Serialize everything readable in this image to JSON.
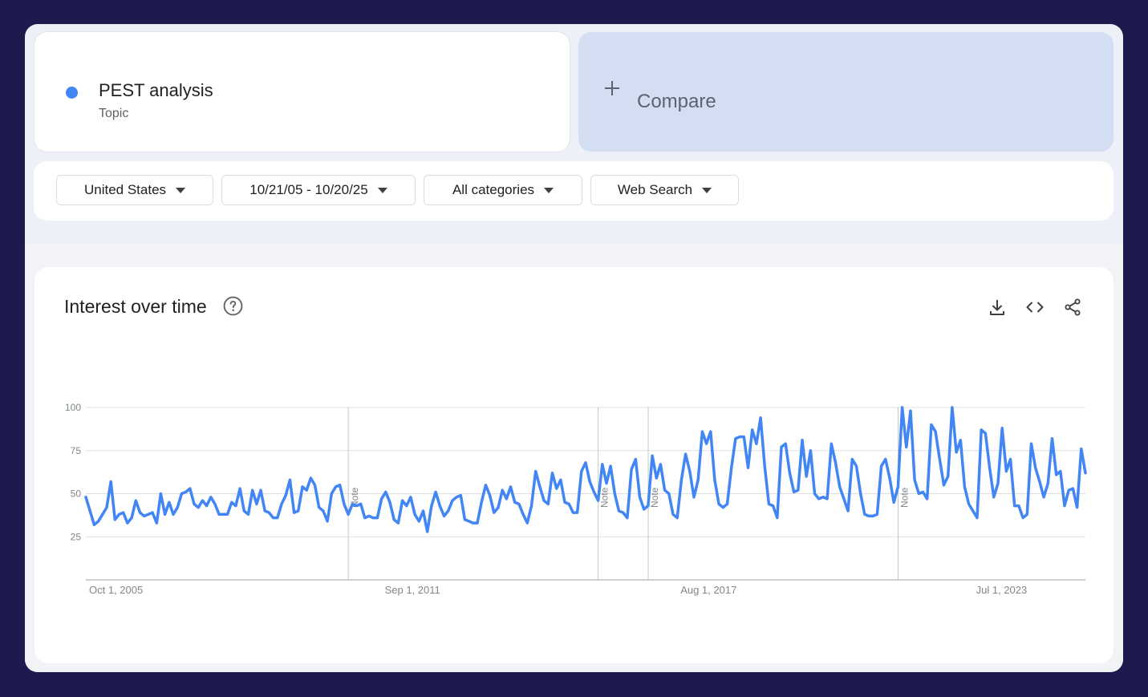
{
  "term": {
    "name": "PEST analysis",
    "type": "Topic",
    "color": "#4285f4"
  },
  "compare": {
    "label": "Compare",
    "icon": "plus-icon"
  },
  "filters": {
    "region": "United States",
    "date_range": "10/21/05 - 10/20/25",
    "category": "All categories",
    "property": "Web Search"
  },
  "chart": {
    "title": "Interest over time",
    "help_icon": "help-circle-icon",
    "actions": [
      "download-icon",
      "embed-code-icon",
      "share-icon"
    ]
  },
  "chart_data": {
    "type": "line",
    "title": "Interest over time",
    "xlabel": "",
    "ylabel": "",
    "ylim": [
      0,
      100
    ],
    "yticks": [
      25,
      50,
      75,
      100
    ],
    "xtick_labels": [
      "Oct 1, 2005",
      "Sep 1, 2011",
      "Aug 1, 2017",
      "Jul 1, 2023"
    ],
    "x_start": "Oct 1, 2005",
    "x_end": "Oct 1, 2025",
    "notes": [
      {
        "label": "Note",
        "date": "Jan 1, 2011"
      },
      {
        "label": "Note",
        "date": "Jan 1, 2016"
      },
      {
        "label": "Note",
        "date": "Jan 1, 2017"
      },
      {
        "label": "Note",
        "date": "Jan 1, 2022"
      }
    ],
    "grid": true,
    "series": [
      {
        "color": "#4285f4",
        "values": [
          48,
          40,
          32,
          34,
          38,
          42,
          57,
          35,
          38,
          39,
          33,
          36,
          46,
          39,
          37,
          38,
          39,
          33,
          50,
          38,
          45,
          38,
          42,
          50,
          51,
          53,
          44,
          42,
          46,
          43,
          48,
          44,
          38,
          38,
          38,
          45,
          43,
          53,
          40,
          38,
          52,
          44,
          52,
          40,
          39,
          36,
          36,
          44,
          49,
          58,
          39,
          40,
          54,
          52,
          59,
          55,
          42,
          40,
          34,
          50,
          54,
          55,
          44,
          38,
          44,
          43,
          44,
          36,
          37,
          36,
          36,
          47,
          51,
          45,
          35,
          33,
          46,
          43,
          48,
          38,
          34,
          40,
          28,
          43,
          51,
          43,
          37,
          40,
          46,
          48,
          49,
          35,
          34,
          33,
          33,
          45,
          55,
          49,
          39,
          42,
          52,
          47,
          54,
          45,
          44,
          38,
          33,
          43,
          63,
          54,
          46,
          44,
          62,
          53,
          58,
          45,
          44,
          39,
          39,
          63,
          68,
          57,
          51,
          46,
          67,
          56,
          66,
          50,
          40,
          39,
          36,
          64,
          70,
          48,
          41,
          43,
          72,
          59,
          67,
          52,
          50,
          38,
          36,
          58,
          73,
          63,
          48,
          58,
          86,
          79,
          86,
          58,
          44,
          42,
          44,
          65,
          82,
          83,
          83,
          65,
          87,
          79,
          94,
          66,
          44,
          43,
          36,
          77,
          79,
          62,
          51,
          52,
          81,
          60,
          75,
          50,
          47,
          48,
          47,
          79,
          68,
          54,
          47,
          40,
          70,
          66,
          50,
          38,
          37,
          37,
          38,
          66,
          70,
          59,
          45,
          54,
          100,
          77,
          98,
          58,
          50,
          51,
          47,
          90,
          86,
          70,
          55,
          60,
          100,
          74,
          81,
          54,
          44,
          40,
          36,
          87,
          85,
          65,
          48,
          56,
          88,
          63,
          70,
          43,
          43,
          36,
          38,
          79,
          65,
          57,
          48,
          56,
          82,
          61,
          63,
          43,
          52,
          53,
          42,
          76,
          62
        ]
      }
    ]
  }
}
